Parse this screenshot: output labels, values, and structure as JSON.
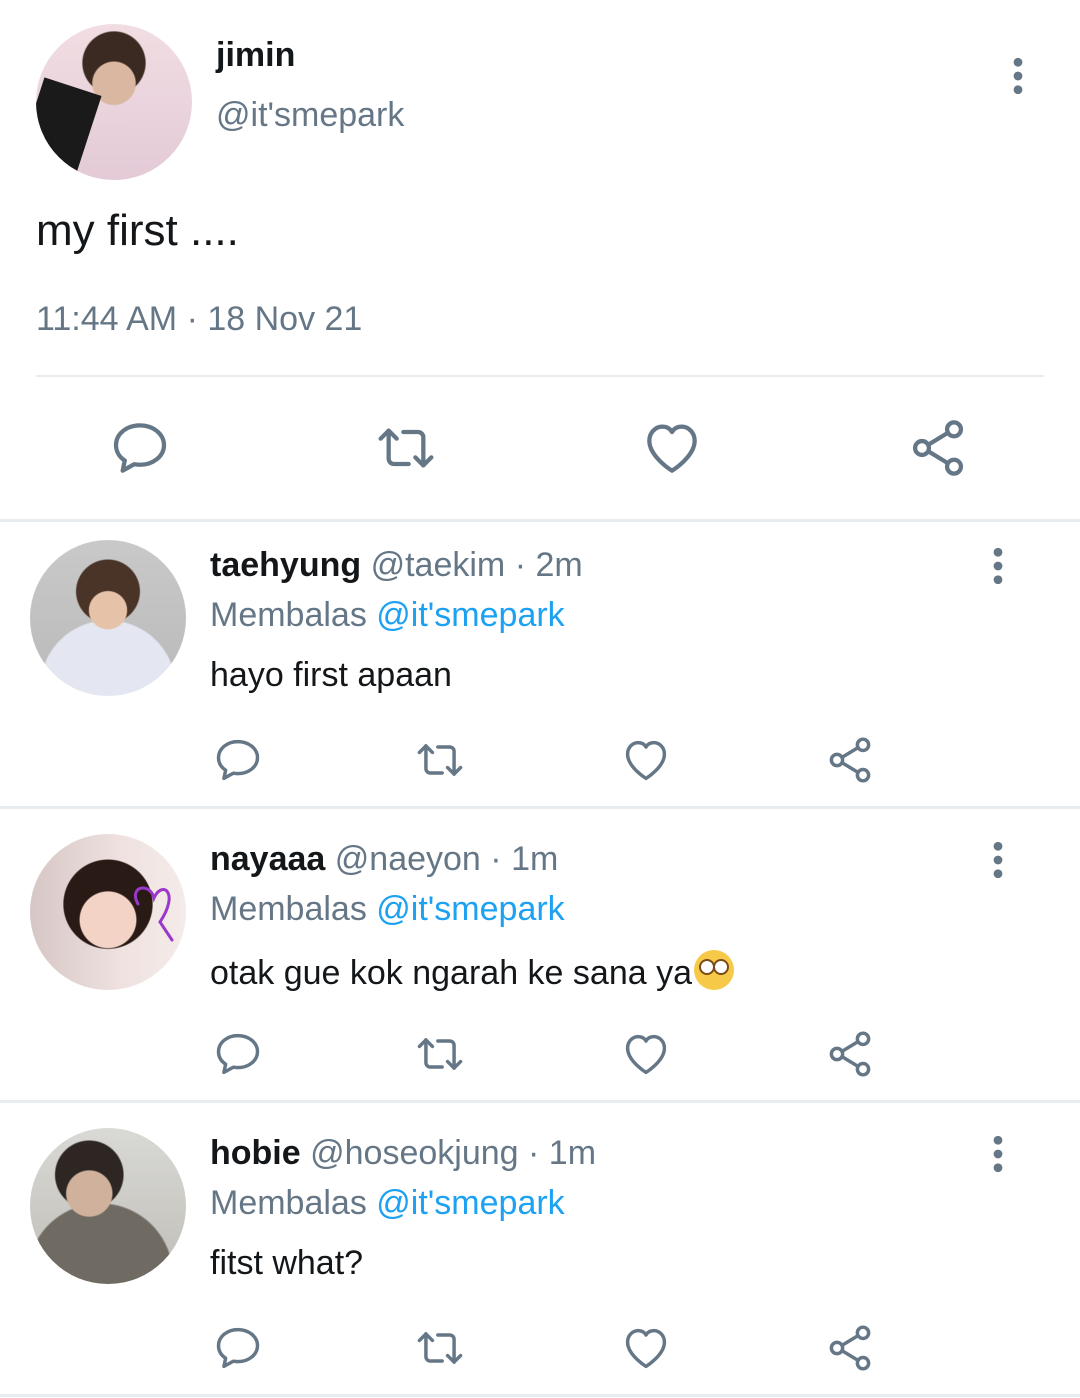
{
  "main_tweet": {
    "name": "jimin",
    "handle": "@it'smepark",
    "text": "my first ....",
    "timestamp": "11:44 AM · 18 Nov 21",
    "actions": [
      "reply-icon",
      "retweet-icon",
      "like-icon",
      "share-icon"
    ]
  },
  "replies": [
    {
      "name": "taehyung",
      "handle": "@taekim",
      "time": "· 2m",
      "membalas_label": "Membalas",
      "reply_to": "@it'smepark",
      "text": "hayo first apaan"
    },
    {
      "name": "nayaaa",
      "handle": "@naeyon",
      "time": "· 1m",
      "membalas_label": "Membalas",
      "reply_to": "@it'smepark",
      "text": "otak gue kok ngarah ke sana ya",
      "emoji": "flushed-face-emoji"
    },
    {
      "name": "hobie",
      "handle": "@hoseokjung",
      "time": "· 1m",
      "membalas_label": "Membalas",
      "reply_to": "@it'smepark",
      "text": "fitst what?"
    }
  ],
  "colors": {
    "text": "#14171a",
    "secondary": "#657786",
    "link": "#1da1f2",
    "divider": "#e6ecf0"
  }
}
